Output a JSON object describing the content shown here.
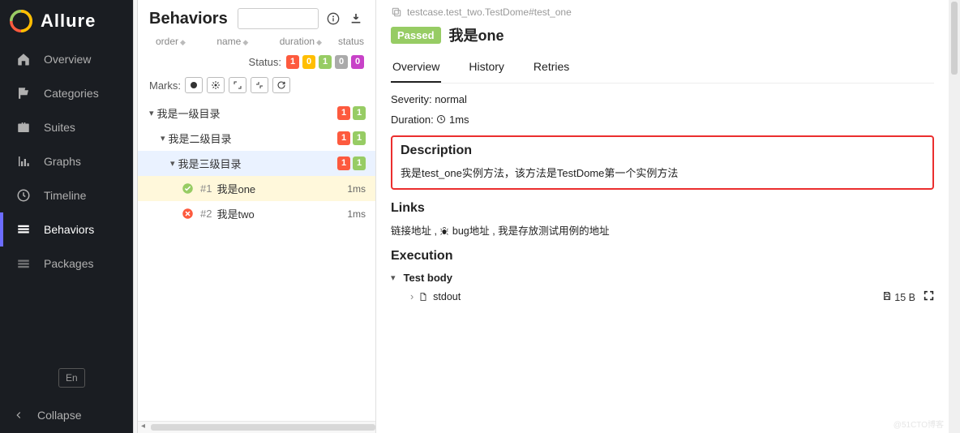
{
  "brand": {
    "title": "Allure"
  },
  "nav": {
    "overview": "Overview",
    "categories": "Categories",
    "suites": "Suites",
    "graphs": "Graphs",
    "timeline": "Timeline",
    "behaviors": "Behaviors",
    "packages": "Packages"
  },
  "sidebar_bottom": {
    "lang": "En",
    "collapse": "Collapse"
  },
  "mid": {
    "title": "Behaviors",
    "cols": {
      "order": "order",
      "name": "name",
      "duration": "duration",
      "status": "status"
    },
    "status_label": "Status:",
    "status_counts": {
      "failed": "1",
      "broken": "0",
      "passed": "1",
      "skipped": "0",
      "unknown": "0"
    },
    "marks_label": "Marks:"
  },
  "tree": {
    "l1": {
      "label": "我是一级目录",
      "counts": {
        "red": "1",
        "green": "1"
      }
    },
    "l2": {
      "label": "我是二级目录",
      "counts": {
        "red": "1",
        "green": "1"
      }
    },
    "l3": {
      "label": "我是三级目录",
      "counts": {
        "red": "1",
        "green": "1"
      }
    },
    "items": [
      {
        "num": "#1",
        "name": "我是one",
        "status": "passed",
        "dur": "1ms"
      },
      {
        "num": "#2",
        "name": "我是two",
        "status": "failed",
        "dur": "1ms"
      }
    ]
  },
  "detail": {
    "crumb": "testcase.test_two.TestDome#test_one",
    "badge": "Passed",
    "title": "我是one",
    "tabs": {
      "overview": "Overview",
      "history": "History",
      "retries": "Retries"
    },
    "severity_label": "Severity:",
    "severity_value": " normal",
    "duration_label": "Duration:",
    "duration_value": " 1ms",
    "desc_h": "Description",
    "desc_text": "我是test_one实例方法，该方法是TestDome第一个实例方法",
    "links_h": "Links",
    "links_text_a": "链接地址 , ",
    "links_text_b": " bug地址 , 我是存放测试用例的地址",
    "exec_h": "Execution",
    "body_label": "Test body",
    "stdout": "stdout",
    "stdout_size": "15 B"
  },
  "watermark": "@51CTO博客"
}
